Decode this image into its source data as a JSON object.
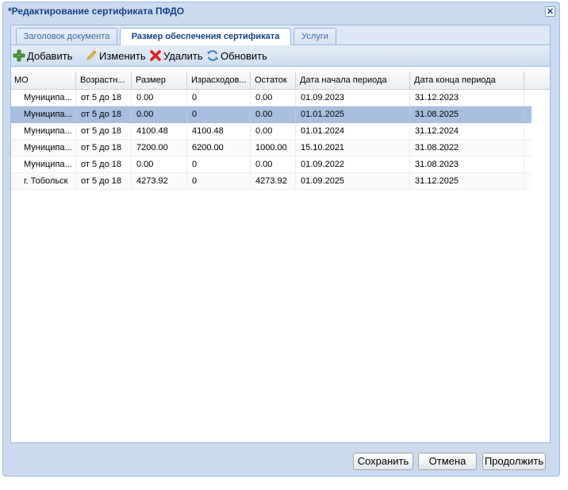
{
  "window": {
    "title": "*Редактирование сертификата ПФДО",
    "close_glyph": "✕"
  },
  "tabs": [
    {
      "label": "Заголовок документа",
      "active": false
    },
    {
      "label": "Размер обеспечения сертификата",
      "active": true
    },
    {
      "label": "Услуги",
      "active": false
    }
  ],
  "toolbar": {
    "add_label": "Добавить",
    "edit_label": "Изменить",
    "delete_label": "Удалить",
    "refresh_label": "Обновить",
    "icons": {
      "add": "plus-icon",
      "edit": "pencil-icon",
      "delete": "red-x-icon",
      "refresh": "refresh-icon"
    }
  },
  "grid": {
    "columns": [
      "МО",
      "Возрастн...",
      "Размер",
      "Израсходов...",
      "Остаток",
      "Дата начала периода",
      "Дата конца периода"
    ],
    "rows": [
      [
        "Муниципа...",
        "от 5 до 18",
        "0.00",
        "0",
        "0.00",
        "01.09.2023",
        "31.12.2023"
      ],
      [
        "Муниципа...",
        "от 5 до 18",
        "0.00",
        "0",
        "0.00",
        "01.01.2025",
        "31.08.2025"
      ],
      [
        "Муниципа...",
        "от 5 до 18",
        "4100.48",
        "4100.48",
        "0.00",
        "01.01.2024",
        "31.12.2024"
      ],
      [
        "Муниципа...",
        "от 5 до 18",
        "7200.00",
        "6200.00",
        "1000.00",
        "15.10.2021",
        "31.08.2022"
      ],
      [
        "Муниципа...",
        "от 5 до 18",
        "0.00",
        "0",
        "0.00",
        "01.09.2022",
        "31.08.2023"
      ],
      [
        "г. Тобольск",
        "от 5 до 18",
        "4273.92",
        "0",
        "4273.92",
        "01.09.2025",
        "31.12.2025"
      ]
    ],
    "selected_row": 1
  },
  "footer": {
    "save_label": "Сохранить",
    "cancel_label": "Отмена",
    "continue_label": "Продолжить"
  },
  "colors": {
    "title": "#15428b",
    "selected_row": "#a8bfe0",
    "window_bg": "#cbdaee"
  }
}
